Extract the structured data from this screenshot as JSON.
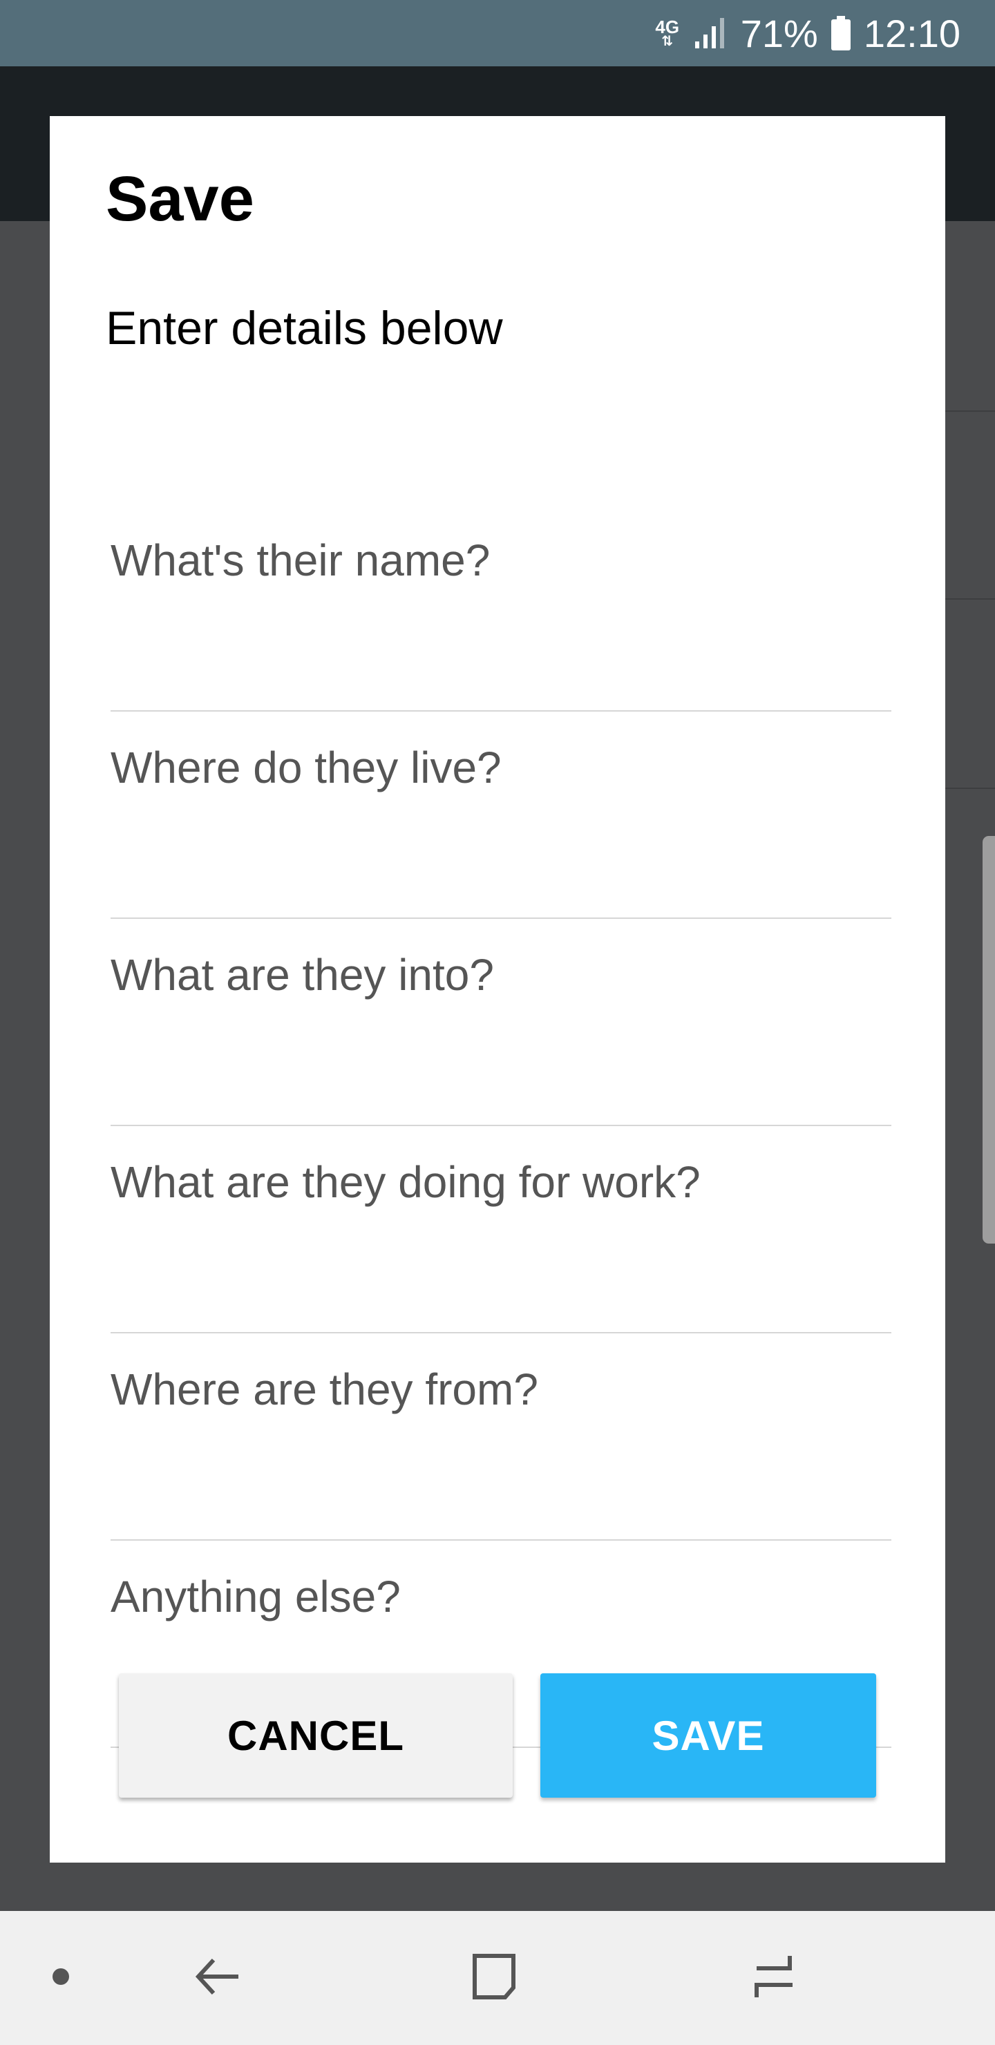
{
  "status_bar": {
    "network": "4G",
    "battery": "71%",
    "time": "12:10"
  },
  "dialog": {
    "title": "Save",
    "subtitle": "Enter details below",
    "fields": [
      {
        "placeholder": "What's their name?",
        "value": ""
      },
      {
        "placeholder": "Where do they live?",
        "value": ""
      },
      {
        "placeholder": "What are they into?",
        "value": ""
      },
      {
        "placeholder": "What are they doing for work?",
        "value": ""
      },
      {
        "placeholder": "Where are they from?",
        "value": ""
      },
      {
        "placeholder": "Anything else?",
        "value": ""
      }
    ],
    "cancel_label": "CANCEL",
    "save_label": "SAVE"
  },
  "nav_bar": {
    "icons": [
      "dot-icon",
      "back-icon",
      "home-icon",
      "recents-icon"
    ]
  },
  "colors": {
    "status_bar": "#546e7a",
    "save_button": "#29b6f6",
    "scrim": "#4a4b4d"
  }
}
